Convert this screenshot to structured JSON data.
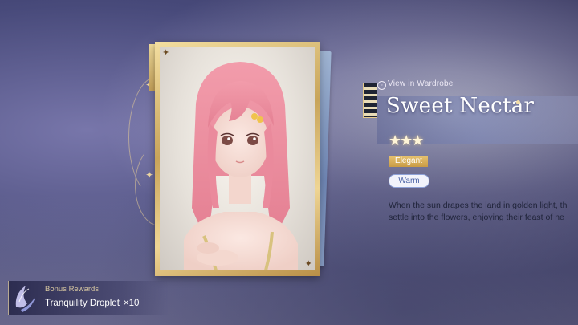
{
  "wardrobe_link": {
    "label": "View in Wardrobe"
  },
  "outfit": {
    "name": "Sweet Nectar",
    "stars": "★★★",
    "star_count": 3,
    "style_tag": "Elegant",
    "mood_tag": "Warm",
    "description_lines": [
      "When the sun drapes the land in golden light, th",
      "settle into the flowers, enjoying their feast of ne"
    ]
  },
  "bonus": {
    "label": "Bonus Rewards",
    "item_name": "Tranquility Droplet",
    "item_qty": "×10",
    "icon": "tranquility-droplet-icon"
  },
  "colors": {
    "gold": "#c9a24f",
    "elegant_tag": "#d4aa55",
    "warm_tag_border": "#8fa2d8",
    "hair": "#ec8fa0"
  }
}
